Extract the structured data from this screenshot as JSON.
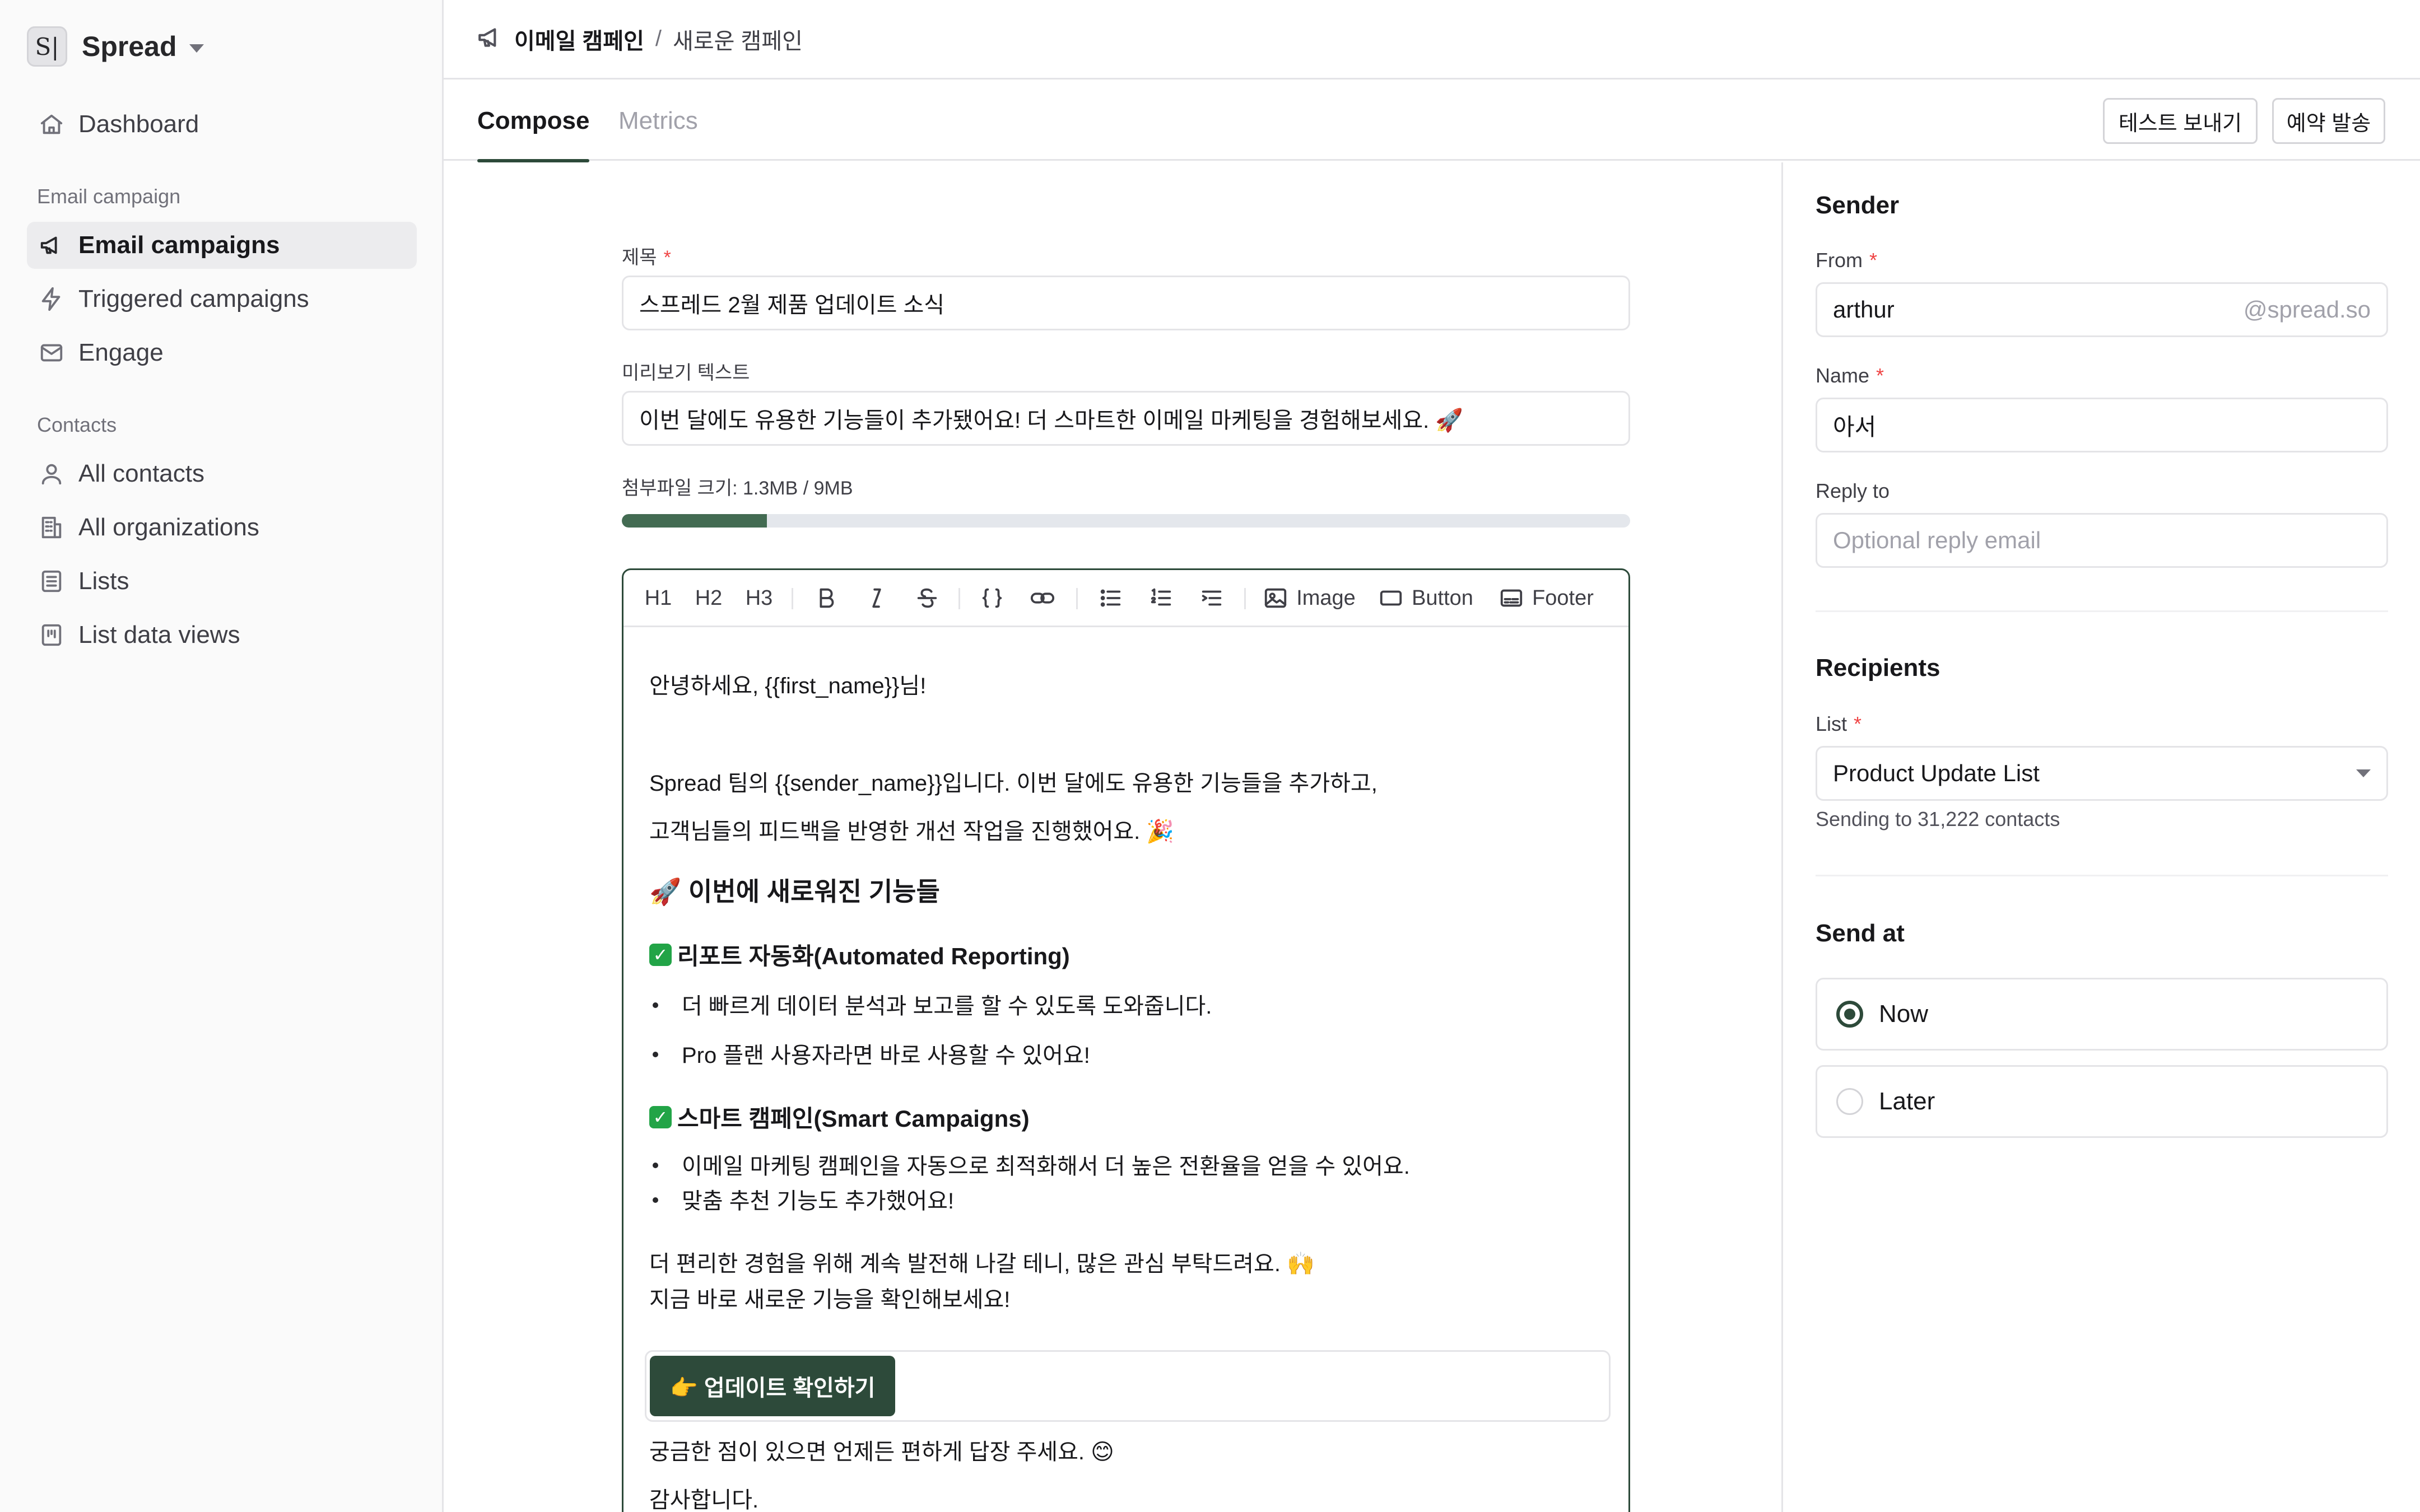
{
  "workspace": {
    "name": "Spread",
    "logo_letter": "S|"
  },
  "sidebar": {
    "top_items": [
      {
        "label": "Dashboard",
        "icon": "home-icon"
      }
    ],
    "sections": [
      {
        "title": "Email campaign",
        "items": [
          {
            "label": "Email campaigns",
            "icon": "megaphone-icon",
            "active": true
          },
          {
            "label": "Triggered campaigns",
            "icon": "lightning-icon"
          },
          {
            "label": "Engage",
            "icon": "envelope-icon"
          }
        ]
      },
      {
        "title": "Contacts",
        "items": [
          {
            "label": "All contacts",
            "icon": "user-icon"
          },
          {
            "label": "All organizations",
            "icon": "building-icon"
          },
          {
            "label": "Lists",
            "icon": "list-icon"
          },
          {
            "label": "List data views",
            "icon": "chart-icon"
          }
        ]
      }
    ]
  },
  "breadcrumb": {
    "icon": "megaphone-icon",
    "parent": "이메일 캠페인",
    "separator": "/",
    "current": "새로운 캠페인"
  },
  "tabs": [
    {
      "label": "Compose",
      "active": true
    },
    {
      "label": "Metrics",
      "active": false
    }
  ],
  "actions": {
    "test_send": "테스트 보내기",
    "schedule": "예약 발송"
  },
  "compose": {
    "subject_label": "제목",
    "required_mark": "*",
    "subject_value": "스프레드 2월 제품 업데이트 소식",
    "preview_label": "미리보기 텍스트",
    "preview_value": "이번 달에도 유용한 기능들이 추가됐어요! 더 스마트한 이메일 마케팅을 경험해보세요. 🚀",
    "attachment_label": "첨부파일 크기: 1.3MB / 9MB",
    "attachment_progress": 0.144
  },
  "toolbar": {
    "h1": "H1",
    "h2": "H2",
    "h3": "H3",
    "image": "Image",
    "button": "Button",
    "footer": "Footer"
  },
  "editor": {
    "greeting": "안녕하세요, {{first_name}}님!",
    "intro_1": "Spread 팀의 {{sender_name}}입니다. 이번 달에도 유용한 기능들을 추가하고,",
    "intro_2": "고객님들의 피드백을 반영한 개선 작업을 진행했어요. 🎉",
    "heading": "🚀 이번에 새로워진 기능들",
    "feature1_title": "리포트 자동화(Automated Reporting)",
    "feature1_bullets": [
      "더 빠르게 데이터 분석과 보고를 할 수 있도록 도와줍니다.",
      "Pro 플랜 사용자라면 바로 사용할 수 있어요!"
    ],
    "feature2_title": "스마트 캠페인(Smart Campaigns)",
    "feature2_bullets": [
      "이메일 마케팅 캠페인을 자동으로 최적화해서 더 높은 전환율을 얻을 수 있어요.",
      "맞춤 추천 기능도 추가했어요!"
    ],
    "outro_1": "더 편리한 경험을 위해 계속 발전해 나갈 테니, 많은 관심 부탁드려요. 🙌",
    "outro_2": "지금 바로 새로운 기능을 확인해보세요!",
    "cta_label": "👉 업데이트 확인하기",
    "closing_1": "궁금한 점이 있으면 언제든 편하게 답장 주세요. 😊",
    "closing_2": "감사합니다."
  },
  "sender": {
    "title": "Sender",
    "from_label": "From",
    "from_value": "arthur",
    "from_domain": "@spread.so",
    "name_label": "Name",
    "name_value": "아서",
    "reply_label": "Reply to",
    "reply_placeholder": "Optional reply email"
  },
  "recipients": {
    "title": "Recipients",
    "list_label": "List",
    "list_value": "Product Update List",
    "hint": "Sending to 31,222 contacts"
  },
  "send_at": {
    "title": "Send at",
    "options": [
      {
        "label": "Now",
        "selected": true
      },
      {
        "label": "Later",
        "selected": false
      }
    ]
  },
  "colors": {
    "accent": "#2d4a3a",
    "progress": "#436b52",
    "required": "#ef4444",
    "check": "#22a447"
  }
}
